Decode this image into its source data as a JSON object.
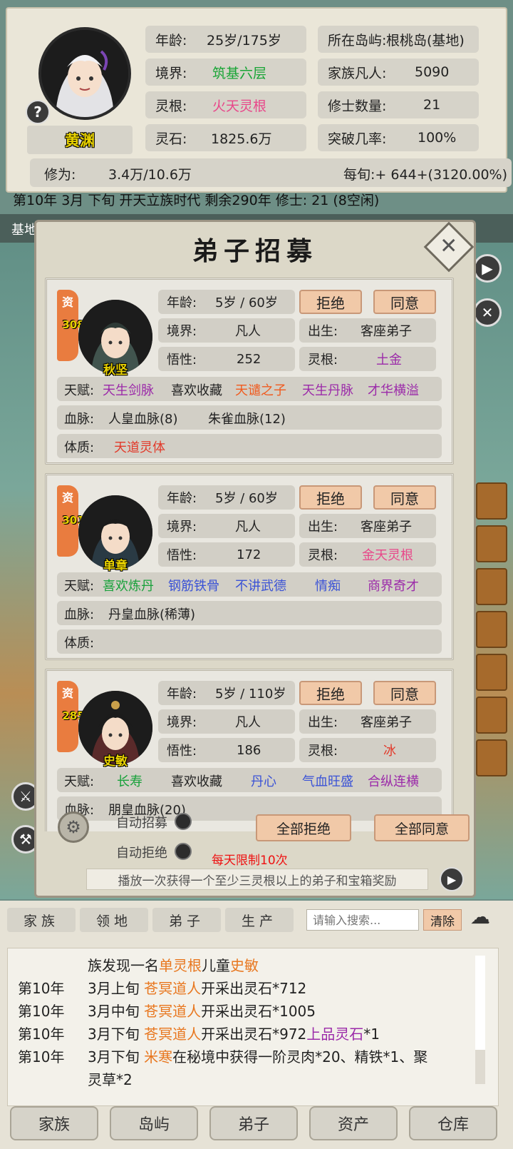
{
  "character": {
    "name": "黄渊",
    "age_label": "年龄:",
    "age_value": "25岁/175岁",
    "realm_label": "境界:",
    "realm_value": "筑基六层",
    "root_label": "灵根:",
    "root_value": "火天灵根",
    "stones_label": "灵石:",
    "stones_value": "1825.6万",
    "island_label": "所在岛屿:",
    "island_value": "根桃岛(基地)",
    "mortals_label": "家族凡人:",
    "mortals_value": "5090",
    "cultivators_label": "修士数量:",
    "cultivators_value": "21",
    "breakthrough_label": "突破几率:",
    "breakthrough_value": "100%",
    "cultivation_label": "修为:",
    "cultivation_value": "3.4万/10.6万",
    "per_period_label": "每旬:+ 644+(3120.00%)",
    "help_glyph": "?"
  },
  "status_line": "第10年 3月 下旬  开天立族时代 剩余290年  修士: 21 (8空闲)",
  "map_header": "基地",
  "dialog": {
    "title": "弟子招募",
    "close_glyph": "✕",
    "candidates": [
      {
        "aptitude_label": "资",
        "aptitude": "308",
        "name": "秋坚",
        "age_label": "年龄:",
        "age": "5岁 / 60岁",
        "realm_label": "境界:",
        "realm": "凡人",
        "comprehension_label": "悟性:",
        "comprehension": "252",
        "origin_label": "出生:",
        "origin": "客座弟子",
        "root_label": "灵根:",
        "root": "土金",
        "reject": "拒绝",
        "accept": "同意",
        "talent_label": "天赋:",
        "talents": [
          "天生剑脉",
          "喜欢收藏",
          "天谴之子",
          "天生丹脉",
          "才华横溢"
        ],
        "bloodline_label": "血脉:",
        "bloodlines": [
          "人皇血脉(8)",
          "朱雀血脉(12)"
        ],
        "physique_label": "体质:",
        "physique": "天道灵体"
      },
      {
        "aptitude_label": "资",
        "aptitude": "301",
        "name": "单章",
        "age_label": "年龄:",
        "age": "5岁 / 60岁",
        "realm_label": "境界:",
        "realm": "凡人",
        "comprehension_label": "悟性:",
        "comprehension": "172",
        "origin_label": "出生:",
        "origin": "客座弟子",
        "root_label": "灵根:",
        "root": "金天灵根",
        "reject": "拒绝",
        "accept": "同意",
        "talent_label": "天赋:",
        "talents": [
          "喜欢炼丹",
          "钢筋铁骨",
          "不讲武德",
          "情痴",
          "商界奇才"
        ],
        "bloodline_label": "血脉:",
        "bloodlines": [
          "丹皇血脉(稀薄)"
        ],
        "physique_label": "体质:",
        "physique": ""
      },
      {
        "aptitude_label": "资",
        "aptitude": "285",
        "name": "史敏",
        "age_label": "年龄:",
        "age": "5岁 / 110岁",
        "realm_label": "境界:",
        "realm": "凡人",
        "comprehension_label": "悟性:",
        "comprehension": "186",
        "origin_label": "出生:",
        "origin": "客座弟子",
        "root_label": "灵根:",
        "root": "冰",
        "reject": "拒绝",
        "accept": "同意",
        "talent_label": "天赋:",
        "talents": [
          "长寿",
          "喜欢收藏",
          "丹心",
          "气血旺盛",
          "合纵连横"
        ],
        "bloodline_label": "血脉:",
        "bloodlines": [
          "朋皇血脉(20)"
        ]
      }
    ],
    "auto_recruit_label": "自动招募",
    "auto_reject_label": "自动拒绝",
    "reject_all": "全部拒绝",
    "accept_all": "全部同意",
    "daily_limit": "每天限制10次",
    "ad_text": "播放一次获得一个至少三灵根以上的弟子和宝箱奖励"
  },
  "lower": {
    "tabs": [
      "家族",
      "领地",
      "弟子",
      "生产"
    ],
    "search_placeholder": "请输入搜索...",
    "clear": "清除",
    "log": [
      {
        "year": "",
        "parts": [
          [
            "族发现一名",
            ""
          ],
          [
            "单灵根",
            "orange"
          ],
          [
            "儿童",
            ""
          ],
          [
            "史敏",
            "orange"
          ]
        ]
      },
      {
        "year": "第10年",
        "parts": [
          [
            "3月上旬 ",
            ""
          ],
          [
            "苍冥道人",
            "orange"
          ],
          [
            "开采出灵石*712",
            ""
          ]
        ]
      },
      {
        "year": "第10年",
        "parts": [
          [
            "3月中旬 ",
            ""
          ],
          [
            "苍冥道人",
            "orange"
          ],
          [
            "开采出灵石*1005",
            ""
          ]
        ]
      },
      {
        "year": "第10年",
        "parts": [
          [
            "3月下旬 ",
            ""
          ],
          [
            "苍冥道人",
            "orange"
          ],
          [
            "开采出灵石*972",
            ""
          ],
          [
            "上品灵石",
            "purple"
          ],
          [
            "*1",
            ""
          ]
        ]
      },
      {
        "year": "第10年",
        "parts": [
          [
            "3月下旬 ",
            ""
          ],
          [
            "米寒",
            "orange"
          ],
          [
            "在秘境中获得一阶灵肉*20、精铁*1、聚",
            ""
          ]
        ]
      },
      {
        "year": "",
        "parts": [
          [
            "灵草*2",
            ""
          ]
        ]
      }
    ],
    "nav": [
      "家族",
      "岛屿",
      "弟子",
      "资产",
      "仓库"
    ]
  }
}
